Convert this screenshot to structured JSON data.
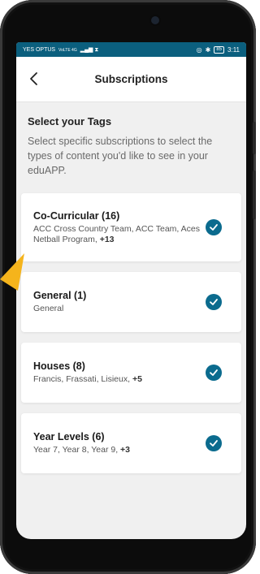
{
  "colors": {
    "accent": "#0b6b8e",
    "status_bar": "#0b5f7e",
    "arrow": "#f5b41c"
  },
  "statusbar": {
    "carrier": "YES OPTUS",
    "network": "VoLTE 4G",
    "battery": "85",
    "time": "3:11"
  },
  "header": {
    "title": "Subscriptions",
    "back_icon": "chevron-left-icon"
  },
  "intro": {
    "heading": "Select your Tags",
    "description": "Select specific subscriptions to select the types of content you'd like to see in your eduAPP."
  },
  "cards": [
    {
      "title": "Co-Curricular (16)",
      "items": "ACC Cross Country Team, ACC Team, Aces Netball Program,",
      "more": "+13",
      "checked": true
    },
    {
      "title": "General (1)",
      "items": "General",
      "more": "",
      "checked": true
    },
    {
      "title": "Houses (8)",
      "items": "Francis, Frassati, Lisieux,",
      "more": "+5",
      "checked": true
    },
    {
      "title": "Year Levels (6)",
      "items": "Year 7, Year 8, Year 9,",
      "more": "+3",
      "checked": true
    }
  ]
}
